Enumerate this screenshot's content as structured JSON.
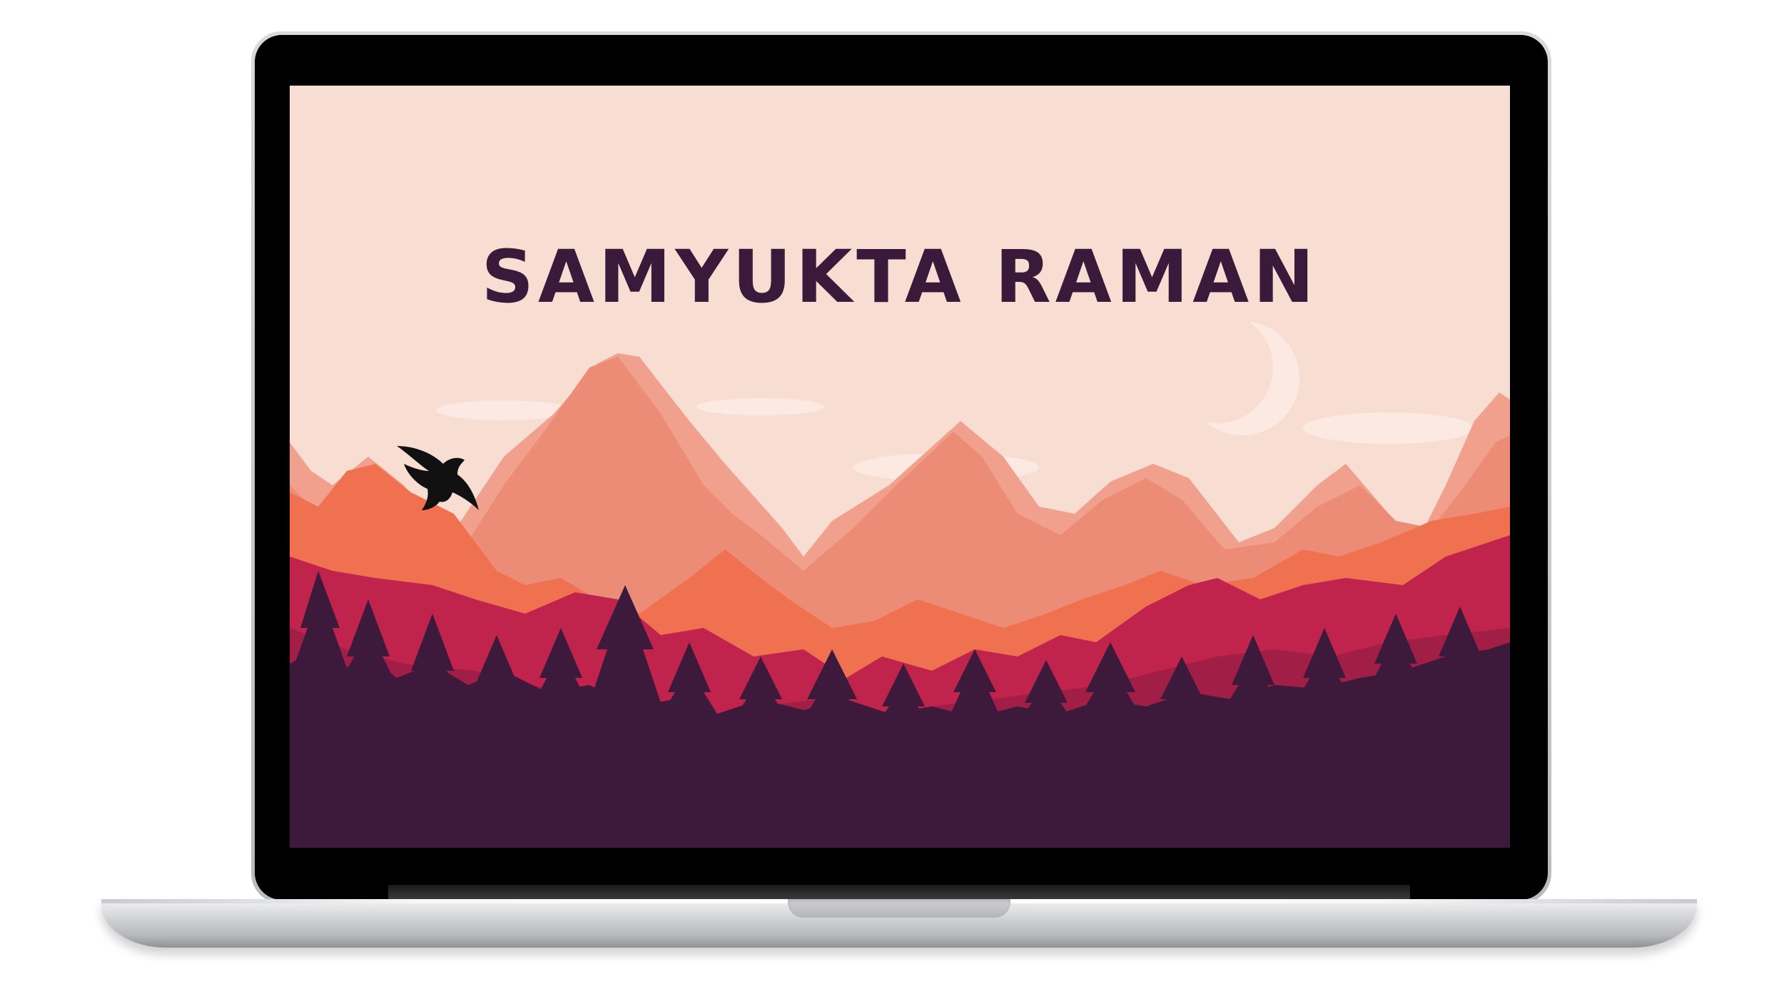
{
  "device": {
    "type": "laptop",
    "bezel_color": "#000000",
    "body_color": "#c9cacd"
  },
  "screen": {
    "title": "SAMYUKTA RAMAN",
    "colors": {
      "sky": "#f8ddd2",
      "cloud": "#fbe9e2",
      "far_mountains": "#ef8c77",
      "mid_mountains": "#f0714f",
      "near_hills": "#c0244c",
      "forest": "#3d1a3c",
      "title": "#3a1a3b"
    },
    "illustration": {
      "elements": [
        "crescent-moon",
        "bird",
        "mountains",
        "pine-forest",
        "clouds"
      ]
    }
  }
}
